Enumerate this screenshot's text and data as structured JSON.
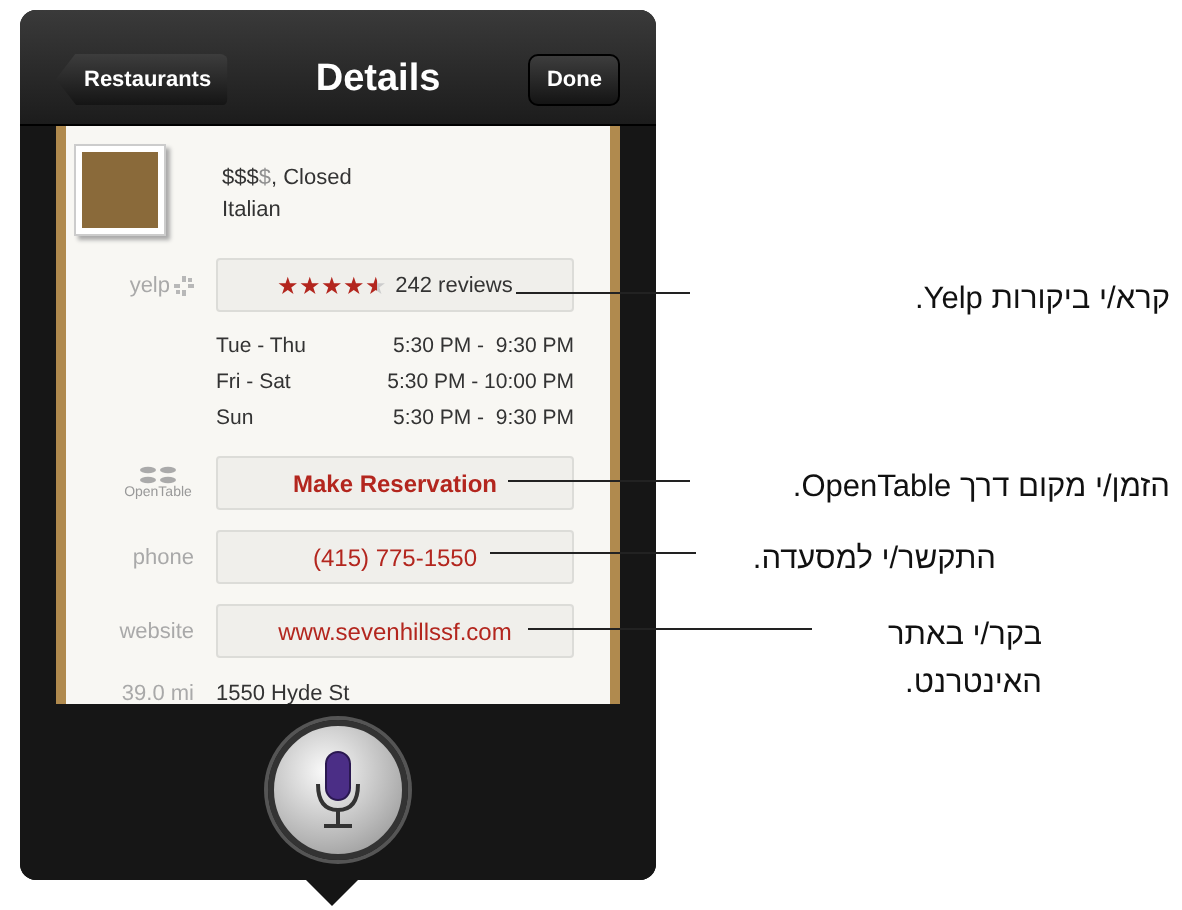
{
  "nav": {
    "back": "Restaurants",
    "title": "Details",
    "done": "Done"
  },
  "restaurant": {
    "price": "$$$",
    "price_rest": "$",
    "status": ", Closed",
    "cuisine": "Italian"
  },
  "yelp": {
    "label": "yelp",
    "stars": 4.5,
    "reviews": "242 reviews"
  },
  "hours": [
    {
      "days": "Tue - Thu",
      "time": "5:30 PM -  9:30 PM"
    },
    {
      "days": "Fri - Sat",
      "time": "5:30 PM - 10:00 PM"
    },
    {
      "days": "Sun",
      "time": "5:30 PM -  9:30 PM"
    }
  ],
  "opentable": {
    "label": "OpenTable",
    "action": "Make Reservation"
  },
  "phone": {
    "label": "phone",
    "value": "(415) 775-1550"
  },
  "website": {
    "label": "website",
    "value": "www.sevenhillssf.com"
  },
  "address": {
    "distance": "39.0 mi",
    "street": "1550 Hyde St"
  },
  "callouts": [
    {
      "text": "קרא/י ביקורות Yelp."
    },
    {
      "text": "הזמן/י מקום דרך OpenTable."
    },
    {
      "text": "התקשר/י למסעדה."
    },
    {
      "text": "בקר/י באתר האינטרנט."
    }
  ]
}
